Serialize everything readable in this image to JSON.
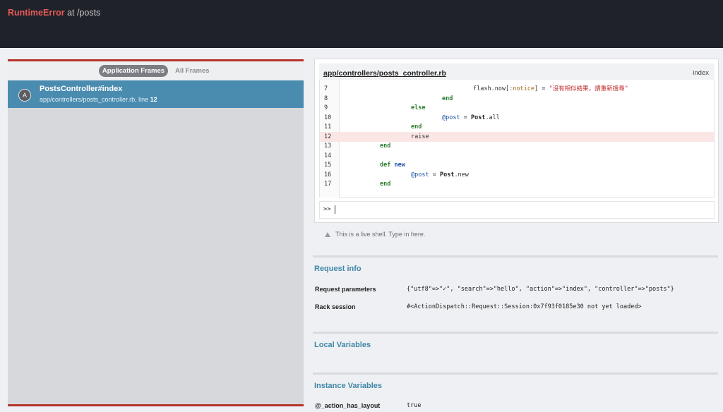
{
  "header": {
    "error_type": "RuntimeError",
    "location": "at /posts"
  },
  "frames": {
    "tabs": [
      "Application Frames",
      "All Frames"
    ],
    "items": [
      {
        "badge": "A",
        "name": "PostsController#index",
        "file": "app/controllers/posts_controller.rb, line ",
        "line": "12"
      }
    ]
  },
  "code": {
    "file": "app/controllers/posts_controller.rb",
    "method": "index",
    "lines": [
      {
        "no": "7",
        "indent": 4,
        "tokens": [
          [
            "",
            "flash.now["
          ],
          [
            "sym",
            ":notice"
          ],
          [
            "",
            "] = "
          ],
          [
            "str",
            "\"沒有相似結果，請重新搜尋\""
          ]
        ]
      },
      {
        "no": "8",
        "indent": 3,
        "tokens": [
          [
            "kw",
            "end"
          ]
        ]
      },
      {
        "no": "9",
        "indent": 2,
        "tokens": [
          [
            "kw",
            "else"
          ]
        ]
      },
      {
        "no": "10",
        "indent": 3,
        "tokens": [
          [
            "ivar",
            "@post"
          ],
          [
            "",
            " = "
          ],
          [
            "const",
            "Post"
          ],
          [
            "",
            ".all"
          ]
        ]
      },
      {
        "no": "11",
        "indent": 2,
        "tokens": [
          [
            "kw",
            "end"
          ]
        ]
      },
      {
        "no": "12",
        "indent": 2,
        "tokens": [
          [
            "",
            "raise"
          ]
        ],
        "highlight": true
      },
      {
        "no": "13",
        "indent": 1,
        "tokens": [
          [
            "kw",
            "end"
          ]
        ]
      },
      {
        "no": "14",
        "indent": 0,
        "tokens": []
      },
      {
        "no": "15",
        "indent": 1,
        "tokens": [
          [
            "kw",
            "def"
          ],
          [
            "",
            " "
          ],
          [
            "kw-blue",
            "new"
          ]
        ]
      },
      {
        "no": "16",
        "indent": 2,
        "tokens": [
          [
            "ivar",
            "@post"
          ],
          [
            "",
            " = "
          ],
          [
            "const",
            "Post"
          ],
          [
            "",
            ".new"
          ]
        ]
      },
      {
        "no": "17",
        "indent": 1,
        "tokens": [
          [
            "kw",
            "end"
          ]
        ]
      }
    ]
  },
  "console": {
    "prompt": ">>"
  },
  "hint": "This is a live shell. Type in here.",
  "request_info": {
    "title": "Request info",
    "rows": [
      {
        "key": "Request parameters",
        "value": "{\"utf8\"=>\"✓\", \"search\"=>\"hello\", \"action\"=>\"index\", \"controller\"=>\"posts\"}"
      },
      {
        "key": "Rack session",
        "value": "#<ActionDispatch::Request::Session:0x7f93f0185e30 not yet loaded>"
      }
    ]
  },
  "local_variables": {
    "title": "Local Variables"
  },
  "instance_variables": {
    "title": "Instance Variables",
    "rows": [
      {
        "key": "@_action_has_layout",
        "value": "true"
      }
    ]
  },
  "colors": {
    "topbar": "#20222a",
    "error_red": "#e55a57",
    "frame_selected": "#4a8cb0",
    "section_title": "#3f87a8",
    "highlight_line": "#fbe6e6"
  }
}
